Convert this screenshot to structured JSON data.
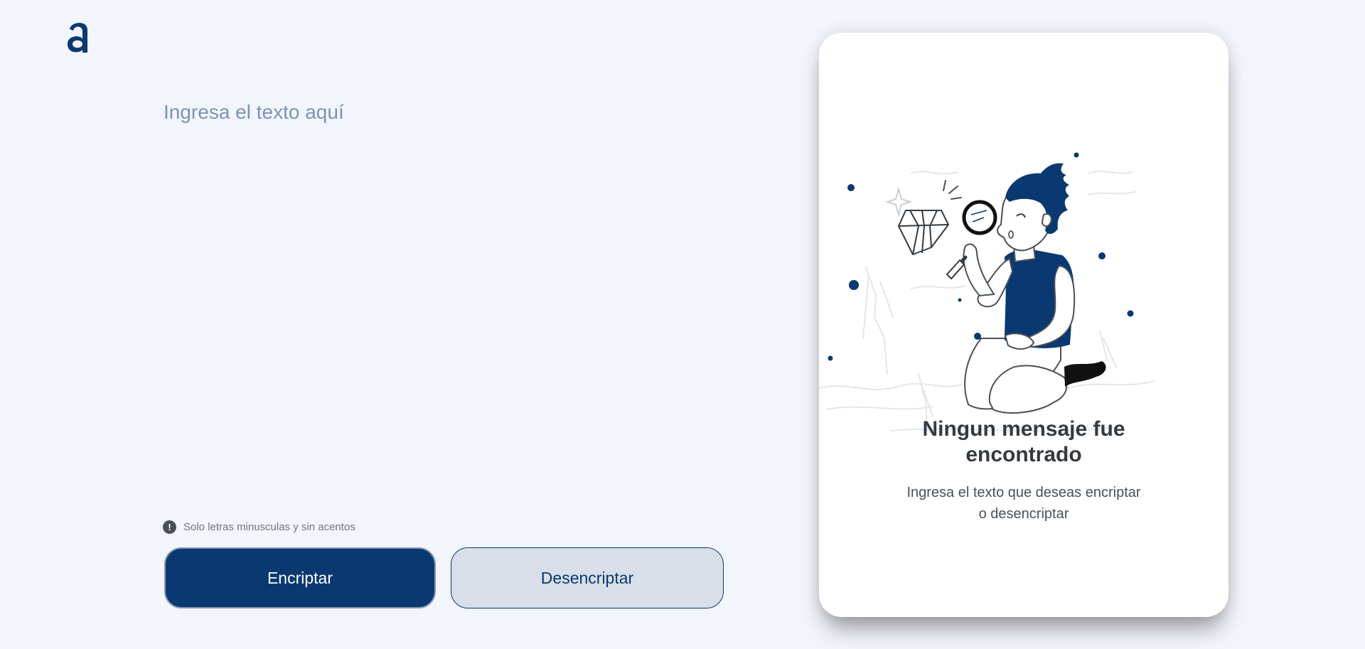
{
  "brand": {
    "logo_icon": "alura-a-logo",
    "accent_color": "#0a3871",
    "background_color": "#f3f5fc"
  },
  "input": {
    "placeholder": "Ingresa el texto aquí",
    "value": ""
  },
  "hint": {
    "icon": "exclamation-circle-icon",
    "text": "Solo letras minusculas y sin acentos"
  },
  "buttons": {
    "encrypt_label": "Encriptar",
    "decrypt_label": "Desencriptar"
  },
  "output_panel": {
    "illustration": "person-with-magnifying-glass-looking-at-diamond",
    "title": "Ningun mensaje fue encontrado",
    "message": "Ingresa el texto que deseas encriptar o desencriptar"
  }
}
